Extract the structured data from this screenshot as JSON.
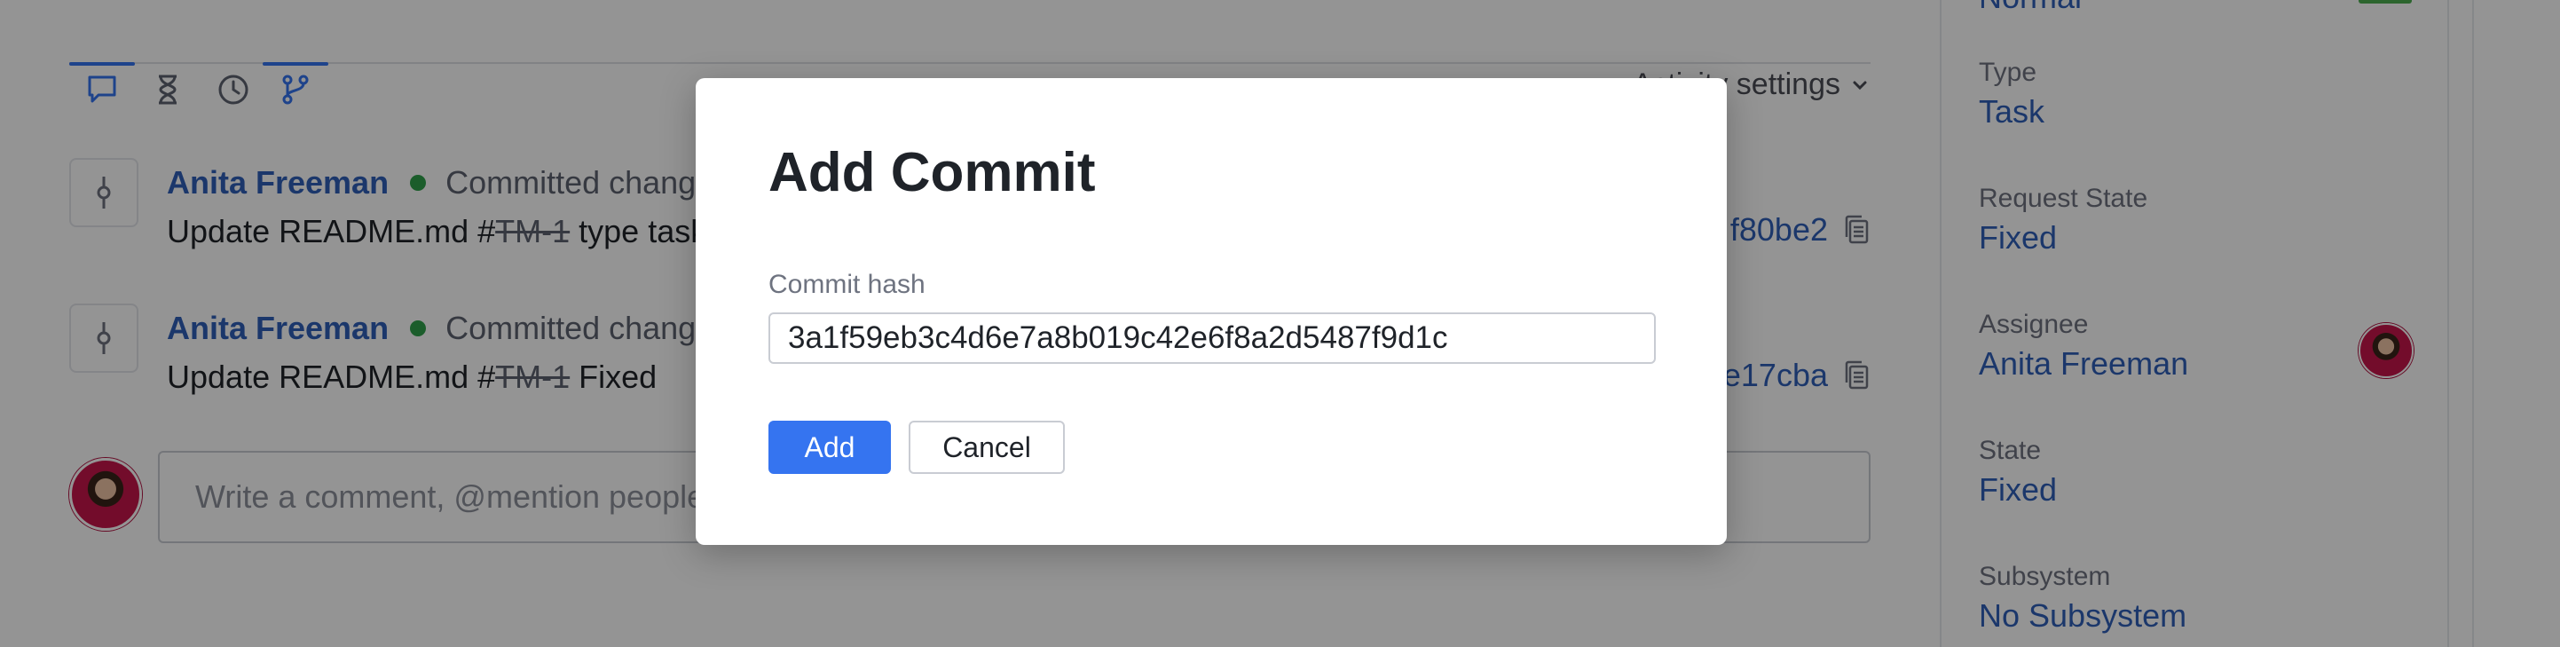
{
  "activity": {
    "tabs": [
      {
        "icon": "comment-icon",
        "active": true
      },
      {
        "icon": "hourglass-icon",
        "active": false
      },
      {
        "icon": "clock-icon",
        "active": false
      },
      {
        "icon": "vcs-branch-icon",
        "active": true
      }
    ],
    "settings_label": "Activity settings",
    "events": [
      {
        "author": "Anita Freeman",
        "action": "Committed changes",
        "message_prefix": "Update README.md #",
        "issue_ref": "TM-1",
        "message_suffix": " type task",
        "commit_short": "f80be2"
      },
      {
        "author": "Anita Freeman",
        "action": "Committed changes",
        "message_prefix": "Update README.md #",
        "issue_ref": "TM-1",
        "message_suffix": " Fixed",
        "commit_short": "e17cba"
      }
    ],
    "comment_placeholder": "Write a comment, @mention people"
  },
  "sidebar": {
    "previous_value": "Normal",
    "fields": {
      "type": {
        "label": "Type",
        "value": "Task"
      },
      "request_state": {
        "label": "Request State",
        "value": "Fixed"
      },
      "assignee": {
        "label": "Assignee",
        "value": "Anita Freeman"
      },
      "state": {
        "label": "State",
        "value": "Fixed"
      },
      "subsystem": {
        "label": "Subsystem",
        "value": "No Subsystem"
      }
    }
  },
  "dialog": {
    "title": "Add Commit",
    "hash_label": "Commit hash",
    "hash_value": "3a1f59eb3c4d6e7a8b019c42e6f8a2d5487f9d1c",
    "add_label": "Add",
    "cancel_label": "Cancel"
  },
  "colors": {
    "accent": "#3574f0",
    "link": "#2f5fb8",
    "online": "#2fa14a"
  }
}
